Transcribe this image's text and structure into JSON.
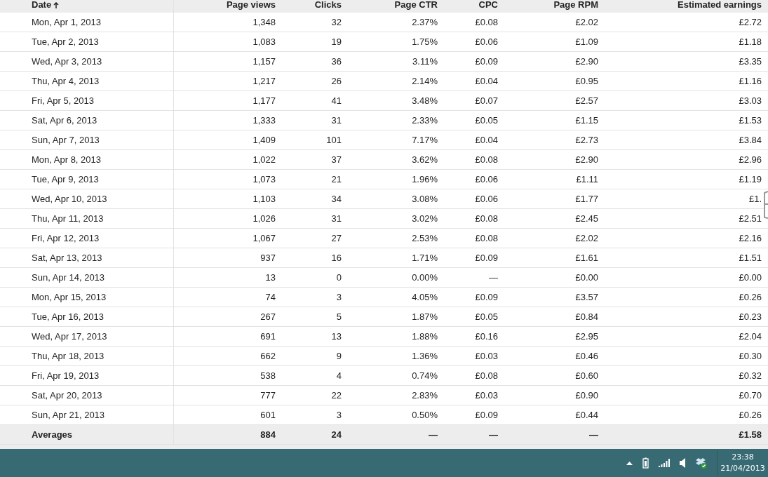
{
  "table": {
    "columns": [
      {
        "label": "Date",
        "sorted": true
      },
      {
        "label": "Page views",
        "sorted": false
      },
      {
        "label": "Clicks",
        "sorted": false
      },
      {
        "label": "Page CTR",
        "sorted": false
      },
      {
        "label": "CPC",
        "sorted": false
      },
      {
        "label": "Page RPM",
        "sorted": false
      },
      {
        "label": "Estimated earnings",
        "sorted": false
      }
    ],
    "rows": [
      [
        "Mon, Apr 1, 2013",
        "1,348",
        "32",
        "2.37%",
        "£0.08",
        "£2.02",
        "£2.72"
      ],
      [
        "Tue, Apr 2, 2013",
        "1,083",
        "19",
        "1.75%",
        "£0.06",
        "£1.09",
        "£1.18"
      ],
      [
        "Wed, Apr 3, 2013",
        "1,157",
        "36",
        "3.11%",
        "£0.09",
        "£2.90",
        "£3.35"
      ],
      [
        "Thu, Apr 4, 2013",
        "1,217",
        "26",
        "2.14%",
        "£0.04",
        "£0.95",
        "£1.16"
      ],
      [
        "Fri, Apr 5, 2013",
        "1,177",
        "41",
        "3.48%",
        "£0.07",
        "£2.57",
        "£3.03"
      ],
      [
        "Sat, Apr 6, 2013",
        "1,333",
        "31",
        "2.33%",
        "£0.05",
        "£1.15",
        "£1.53"
      ],
      [
        "Sun, Apr 7, 2013",
        "1,409",
        "101",
        "7.17%",
        "£0.04",
        "£2.73",
        "£3.84"
      ],
      [
        "Mon, Apr 8, 2013",
        "1,022",
        "37",
        "3.62%",
        "£0.08",
        "£2.90",
        "£2.96"
      ],
      [
        "Tue, Apr 9, 2013",
        "1,073",
        "21",
        "1.96%",
        "£0.06",
        "£1.11",
        "£1.19"
      ],
      [
        "Wed, Apr 10, 2013",
        "1,103",
        "34",
        "3.08%",
        "£0.06",
        "£1.77",
        "£1."
      ],
      [
        "Thu, Apr 11, 2013",
        "1,026",
        "31",
        "3.02%",
        "£0.08",
        "£2.45",
        "£2.51"
      ],
      [
        "Fri, Apr 12, 2013",
        "1,067",
        "27",
        "2.53%",
        "£0.08",
        "£2.02",
        "£2.16"
      ],
      [
        "Sat, Apr 13, 2013",
        "937",
        "16",
        "1.71%",
        "£0.09",
        "£1.61",
        "£1.51"
      ],
      [
        "Sun, Apr 14, 2013",
        "13",
        "0",
        "0.00%",
        "—",
        "£0.00",
        "£0.00"
      ],
      [
        "Mon, Apr 15, 2013",
        "74",
        "3",
        "4.05%",
        "£0.09",
        "£3.57",
        "£0.26"
      ],
      [
        "Tue, Apr 16, 2013",
        "267",
        "5",
        "1.87%",
        "£0.05",
        "£0.84",
        "£0.23"
      ],
      [
        "Wed, Apr 17, 2013",
        "691",
        "13",
        "1.88%",
        "£0.16",
        "£2.95",
        "£2.04"
      ],
      [
        "Thu, Apr 18, 2013",
        "662",
        "9",
        "1.36%",
        "£0.03",
        "£0.46",
        "£0.30"
      ],
      [
        "Fri, Apr 19, 2013",
        "538",
        "4",
        "0.74%",
        "£0.08",
        "£0.60",
        "£0.32"
      ],
      [
        "Sat, Apr 20, 2013",
        "777",
        "22",
        "2.83%",
        "£0.03",
        "£0.90",
        "£0.70"
      ],
      [
        "Sun, Apr 21, 2013",
        "601",
        "3",
        "0.50%",
        "£0.09",
        "£0.44",
        "£0.26"
      ]
    ],
    "averages": [
      "Averages",
      "884",
      "24",
      "—",
      "—",
      "—",
      "£1.58"
    ]
  },
  "taskbar": {
    "time": "23:38",
    "date": "21/04/2013"
  }
}
